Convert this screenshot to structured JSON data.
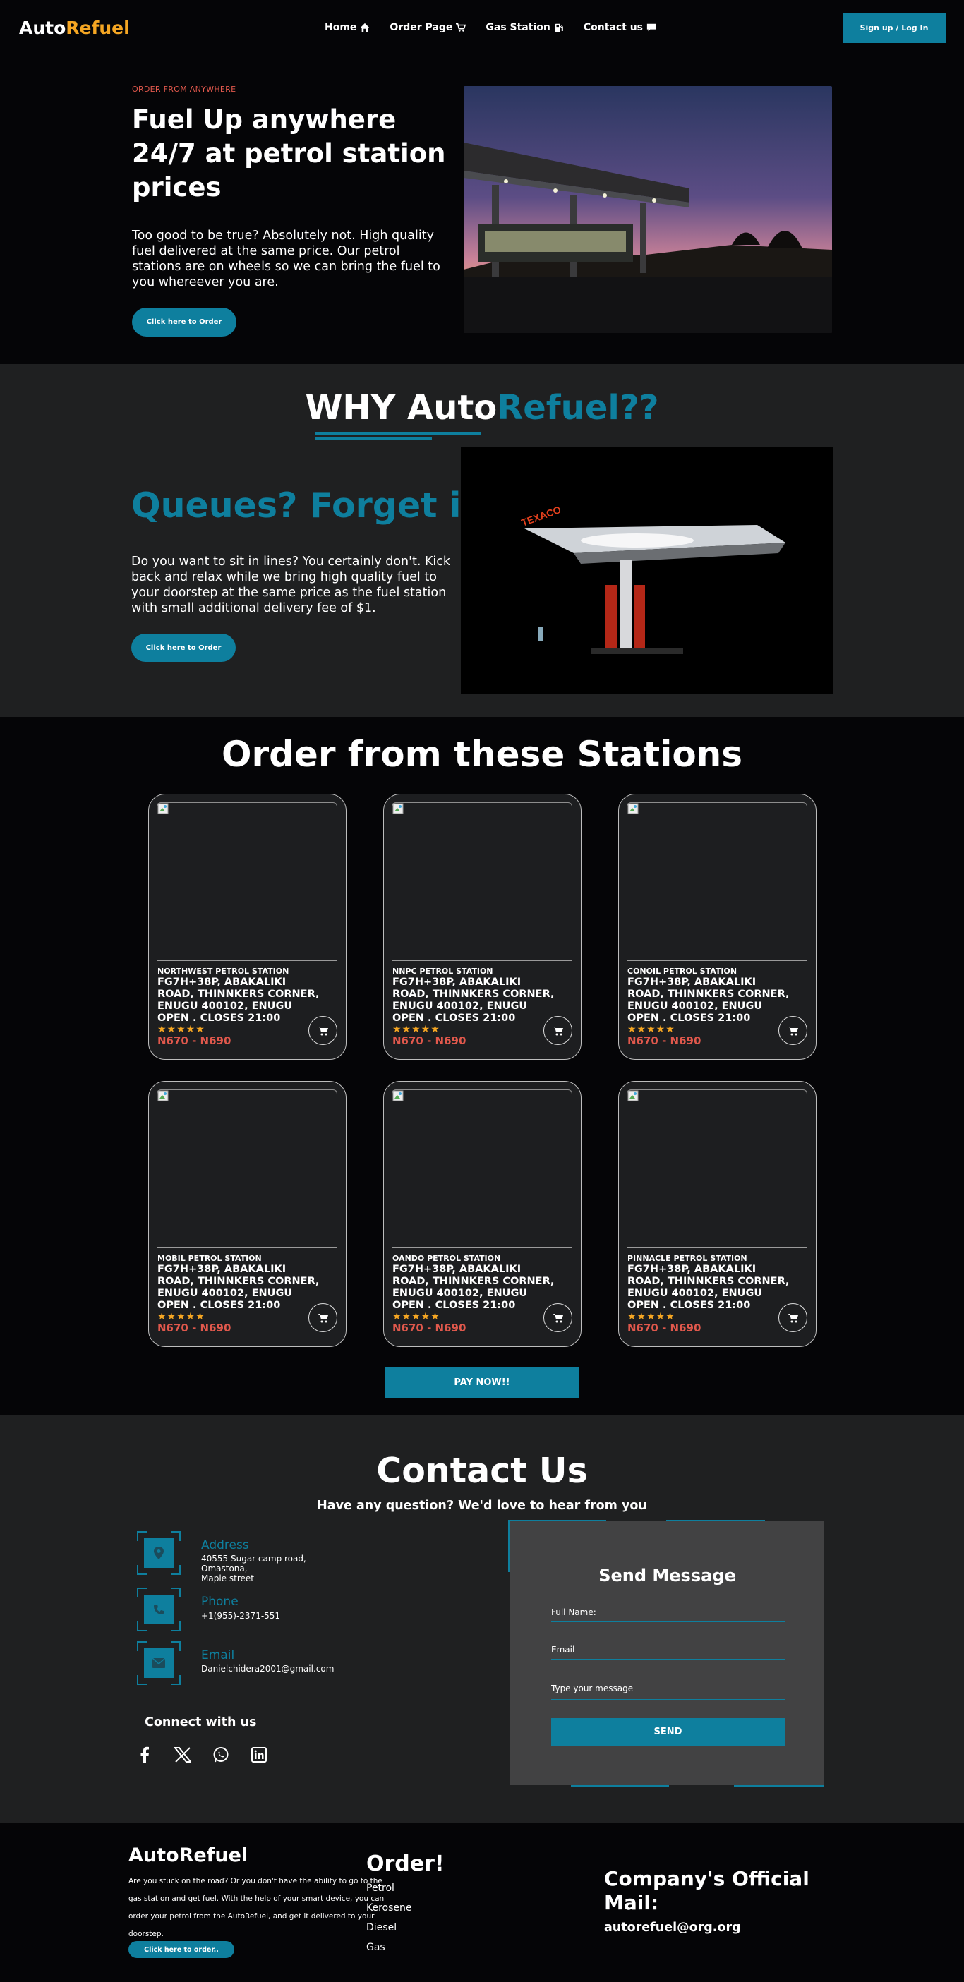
{
  "nav": {
    "logo_a": "Auto",
    "logo_b": "Refuel",
    "links": [
      "Home",
      "Order Page",
      "Gas Station",
      "Contact us"
    ],
    "signup": "Sign up / Log In"
  },
  "hero": {
    "tag": "ORDER FROM ANYWHERE",
    "title": "Fuel Up anywhere 24/7 at petrol station prices",
    "text": "Too good to be true? Absolutely not. High quality fuel delivered at the same price. Our petrol stations are on wheels so we can bring the fuel to you whereever you are.",
    "button": "Click here to Order"
  },
  "why": {
    "title_a": "WHY Auto",
    "title_b": "Refuel??",
    "subtitle": "Queues? Forget it",
    "text": "Do you want to sit in lines? You certainly don't. Kick back and relax while we bring high quality fuel to your doorstep at the same price as the fuel station with small additional delivery fee of $1.",
    "button": "Click here to Order"
  },
  "stations": {
    "title": "Order from these Stations",
    "cards": [
      {
        "name": "NORTHWEST PETROL STATION",
        "address": "FG7H+38P, ABAKALIKI ROAD, THINNKERS CORNER, ENUGU 400102, ENUGU",
        "hours": "OPEN . CLOSES 21:00",
        "stars": "★★★★★",
        "price": "N670 - N690"
      },
      {
        "name": "NNPC PETROL STATION",
        "address": "FG7H+38P, ABAKALIKI ROAD, THINNKERS CORNER, ENUGU 400102, ENUGU",
        "hours": "OPEN . CLOSES 21:00",
        "stars": "★★★★★",
        "price": "N670 - N690"
      },
      {
        "name": "CONOIL PETROL STATION",
        "address": "FG7H+38P, ABAKALIKI ROAD, THINNKERS CORNER, ENUGU 400102, ENUGU",
        "hours": "OPEN . CLOSES 21:00",
        "stars": "★★★★★",
        "price": "N670 - N690"
      },
      {
        "name": "MOBIL PETROL STATION",
        "address": "FG7H+38P, ABAKALIKI ROAD, THINNKERS CORNER, ENUGU 400102, ENUGU",
        "hours": "OPEN . CLOSES 21:00",
        "stars": "★★★★★",
        "price": "N670 - N690"
      },
      {
        "name": "OANDO PETROL STATION",
        "address": "FG7H+38P, ABAKALIKI ROAD, THINNKERS CORNER, ENUGU 400102, ENUGU",
        "hours": "OPEN . CLOSES 21:00",
        "stars": "★★★★★",
        "price": "N670 - N690"
      },
      {
        "name": "PINNACLE PETROL STATION",
        "address": "FG7H+38P, ABAKALIKI ROAD, THINNKERS CORNER, ENUGU 400102, ENUGU",
        "hours": "OPEN . CLOSES 21:00",
        "stars": "★★★★★",
        "price": "N670 - N690"
      }
    ],
    "pay_button": "PAY NOW!!"
  },
  "contact": {
    "title": "Contact Us",
    "subtitle": "Have any question? We'd love to hear from you",
    "address_label": "Address",
    "address_lines": [
      "40555 Sugar camp road,",
      "Omastona,",
      "Maple street"
    ],
    "phone_label": "Phone",
    "phone": "+1(955)-2371-551",
    "email_label": "Email",
    "email": "Danielchidera2001@gmail.com",
    "connect": "Connect with us",
    "socials": [
      "facebook-icon",
      "x-icon",
      "whatsapp-icon",
      "linkedin-icon"
    ],
    "form": {
      "title": "Send Message",
      "name_placeholder": "Full Name:",
      "email_placeholder": "Email",
      "message_placeholder": "Type your message",
      "send": "SEND"
    }
  },
  "footer": {
    "logo": "AutoRefuel",
    "text": "Are you stuck on the road? Or you don't have the ability to go to the gas station and get fuel. With the help of your smart device, you can order your petrol from the AutoRefuel, and get it delivered to your doorstep.",
    "button": "Click here to order..",
    "order_title": "Order!",
    "order_items": [
      "Petrol",
      "Kerosene",
      "Diesel",
      "Gas"
    ],
    "mail_title": "Company's Official Mail:",
    "mail": "autorefuel@org.org"
  },
  "colors": {
    "accent": "#0e7f9e",
    "brand": "#f5a623",
    "price": "#e0584c"
  }
}
